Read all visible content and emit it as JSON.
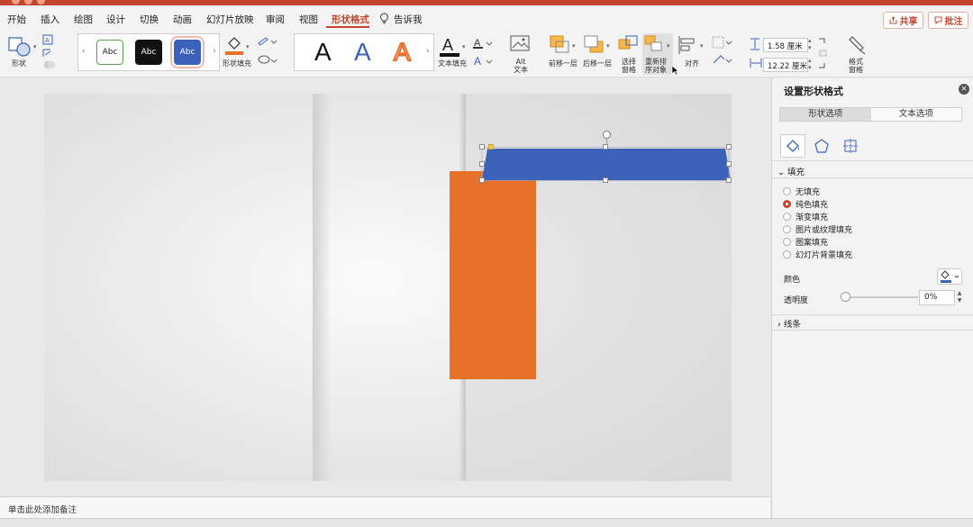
{
  "menu": {
    "tabs": [
      "开始",
      "插入",
      "绘图",
      "设计",
      "切换",
      "动画",
      "幻灯片放映",
      "审阅",
      "视图",
      "形状格式"
    ],
    "active_tab": "形状格式",
    "tell_me": "告诉我",
    "share_label": "共享",
    "comment_label": "批注"
  },
  "ribbon": {
    "shape_label": "形状",
    "style_samples": [
      "Abc",
      "Abc",
      "Abc"
    ],
    "shape_fill_label": "形状填充",
    "wordart_letters": [
      "A",
      "A",
      "A"
    ],
    "text_fill_label": "文本填充",
    "alt_text_label": "Alt\n文本",
    "bring_forward_label": "前移一层",
    "send_backward_label": "后移一层",
    "selection_pane_label": "选择\n窗格",
    "reorder_label": "重新排\n序对象",
    "align_label": "对齐",
    "height_value": "1.58 厘米",
    "width_value": "12.22 厘米",
    "format_pane_label": "格式\n窗格"
  },
  "notes": {
    "placeholder": "单击此处添加备注"
  },
  "pane": {
    "title": "设置形状格式",
    "tabs": [
      "形状选项",
      "文本选项"
    ],
    "active_tab": "形状选项",
    "fill_header": "填充",
    "fill_options": [
      "无填充",
      "纯色填充",
      "渐变填充",
      "图片或纹理填充",
      "图案填充",
      "幻灯片背景填充"
    ],
    "fill_selected": "纯色填充",
    "color_label": "颜色",
    "transparency_label": "透明度",
    "transparency_value": "0%",
    "line_header": "线条"
  },
  "colors": {
    "accent": "#c4452d",
    "blue_shape": "#3b62b8",
    "orange_shape": "#e8712a"
  }
}
